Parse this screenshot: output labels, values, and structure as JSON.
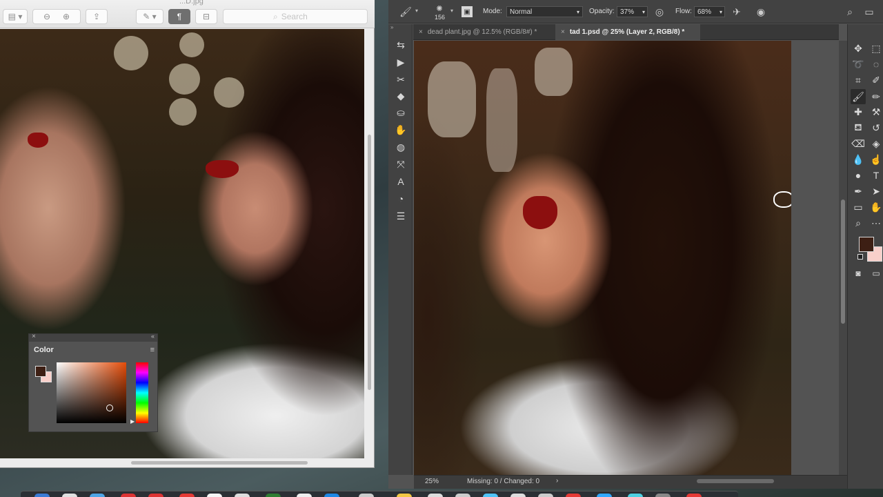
{
  "preview": {
    "title": "...D.jpg",
    "search_placeholder": "Search",
    "icons": [
      "sidebar-icon",
      "zoom-out-icon",
      "zoom-in-icon",
      "share-icon",
      "markup-pen-icon",
      "paragraph-icon",
      "toolbox-icon",
      "search-icon"
    ]
  },
  "color_panel": {
    "title": "Color",
    "foreground": "#3d1f14",
    "background": "#f8cfca",
    "hue": "#e54d0a"
  },
  "photoshop": {
    "options": {
      "brush_size": "156",
      "mode_label": "Mode:",
      "mode_value": "Normal",
      "opacity_label": "Opacity:",
      "opacity_value": "37%",
      "flow_label": "Flow:",
      "flow_value": "68%"
    },
    "tabs": [
      {
        "label": "dead plant.jpg @ 12.5% (RGB/8#) *",
        "active": false
      },
      {
        "label": "tad 1.psd @ 25% (Layer 2, RGB/8) *",
        "active": true
      }
    ],
    "status": {
      "zoom": "25%",
      "info": "Missing: 0 / Changed: 0"
    },
    "foreground_color": "#3d1f14",
    "background_color": "#f8cfca"
  }
}
